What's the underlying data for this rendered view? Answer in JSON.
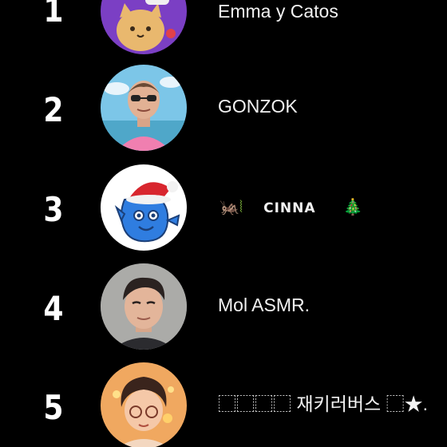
{
  "leaderboard": [
    {
      "rank": "1",
      "name": "Emma y Catos",
      "avatar_icon": "cat-avatar-icon"
    },
    {
      "rank": "2",
      "name": "GONZOK",
      "avatar_icon": "person-sunglasses-avatar-icon"
    },
    {
      "rank": "3",
      "name_prefix": "🦗⦚",
      "name_main": "CINNA",
      "name_suffix": "🎄",
      "avatar_icon": "blue-santa-character-avatar-icon"
    },
    {
      "rank": "4",
      "name": "Mol ASMR.",
      "avatar_icon": "person-avatar-icon"
    },
    {
      "rank": "5",
      "name": "⬚⬚⬚⬚ 재키러버스 ⬚★.",
      "avatar_icon": "anime-character-avatar-icon"
    }
  ],
  "colors": {
    "background": "#000000",
    "text": "#ffffff",
    "avatar_1_bg": "#7b3fc4",
    "avatar_3_bg": "#ffffff"
  }
}
